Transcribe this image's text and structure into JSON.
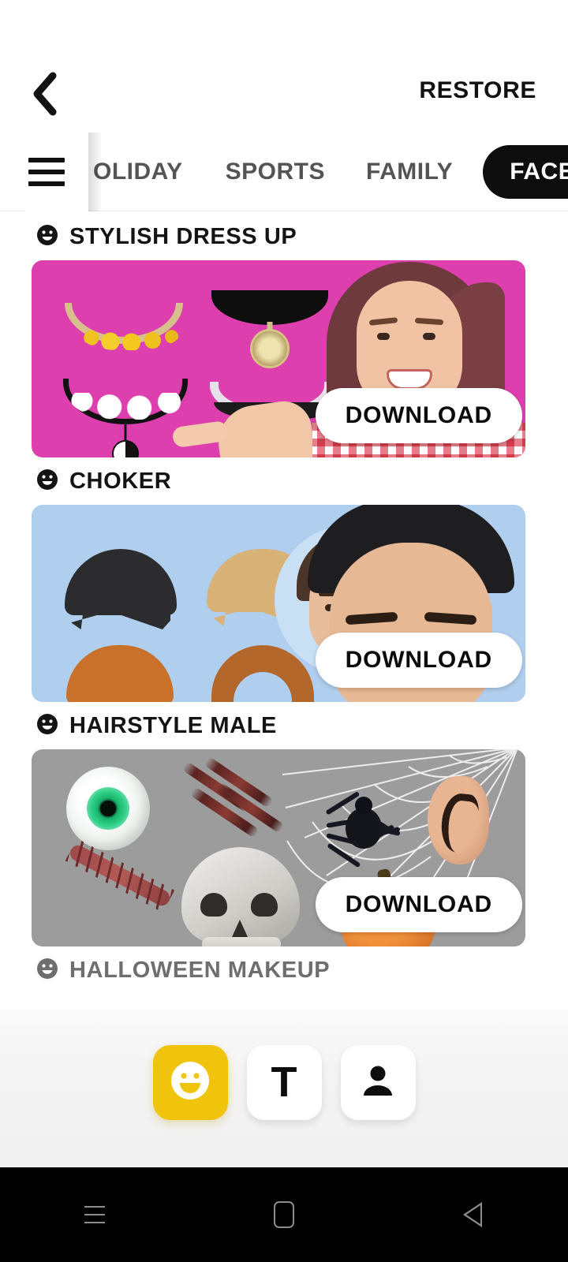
{
  "header": {
    "back_icon": "back-chevron-icon",
    "restore_label": "RESTORE"
  },
  "tabbar": {
    "menu_icon": "hamburger-menu-icon",
    "tabs": [
      {
        "label": "OLIDAY",
        "active": false
      },
      {
        "label": "SPORTS",
        "active": false
      },
      {
        "label": "FAMILY",
        "active": false
      },
      {
        "label": "FACE PLAY",
        "active": true
      }
    ],
    "active_bg": "#0d0d0d",
    "active_fg": "#ffffff",
    "inactive_fg": "#545454"
  },
  "sections": [
    {
      "label": "STYLISH DRESS UP",
      "icon": "smiley-face-icon",
      "dimmed": false,
      "card": {
        "name": "choker-pack-card",
        "bg_color": "#dd40ae",
        "download_label": "DOWNLOAD"
      }
    },
    {
      "label": "CHOKER",
      "icon": "smiley-face-icon",
      "dimmed": false,
      "card": {
        "name": "hairstyle-male-card",
        "bg_color": "#b0cfee",
        "download_label": "DOWNLOAD"
      }
    },
    {
      "label": "HAIRSTYLE MALE",
      "icon": "smiley-face-icon",
      "dimmed": false,
      "card": {
        "name": "halloween-makeup-card",
        "bg_color": "#9c9c9c",
        "download_label": "DOWNLOAD"
      }
    },
    {
      "label": "HALLOWEEN MAKEUP",
      "icon": "smiley-face-icon",
      "dimmed": true
    }
  ],
  "bottom_toolbar": {
    "active_color": "#f0c40c",
    "tools": [
      {
        "name": "stickers-tool",
        "icon": "smiley-face-icon",
        "label": "",
        "active": true
      },
      {
        "name": "text-tool",
        "icon": "text-t-icon",
        "label": "T",
        "active": false
      },
      {
        "name": "profile-tool",
        "icon": "person-icon",
        "label": "",
        "active": false
      }
    ]
  },
  "android_navbar": {
    "recents_icon": "recents-icon",
    "home_icon": "home-icon",
    "back_icon": "back-triangle-icon"
  }
}
